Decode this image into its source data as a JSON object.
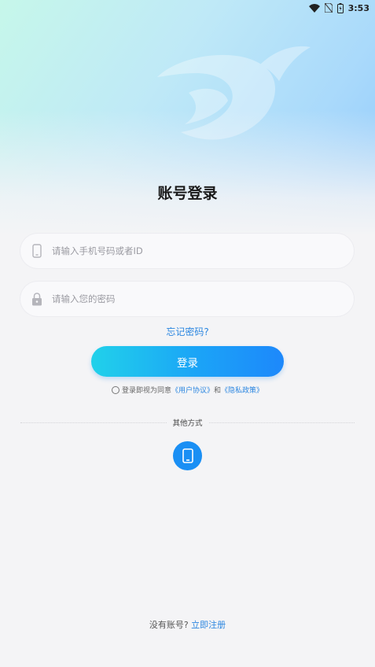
{
  "status_bar": {
    "time": "3:53",
    "icons": [
      "wifi-icon",
      "no-sim-icon",
      "battery-icon"
    ]
  },
  "page": {
    "title": "账号登录"
  },
  "form": {
    "phone_placeholder": "请输入手机号码或者ID",
    "password_placeholder": "请输入您的密码",
    "forgot_label": "忘记密码?",
    "login_label": "登录"
  },
  "agreement": {
    "prefix": "登录即视为同意",
    "user_agreement": "《用户协议》",
    "conjunction": "和",
    "privacy_policy": "《隐私政策》"
  },
  "alt_login": {
    "divider_label": "其他方式",
    "icon": "mobile-phone-icon"
  },
  "footer": {
    "no_account": "没有账号?",
    "register_label": "立即注册"
  },
  "colors": {
    "accent": "#2b86e0",
    "button_start": "#21d1ea",
    "button_end": "#1d88fb",
    "alt_icon_bg": "#1a8ff4"
  }
}
